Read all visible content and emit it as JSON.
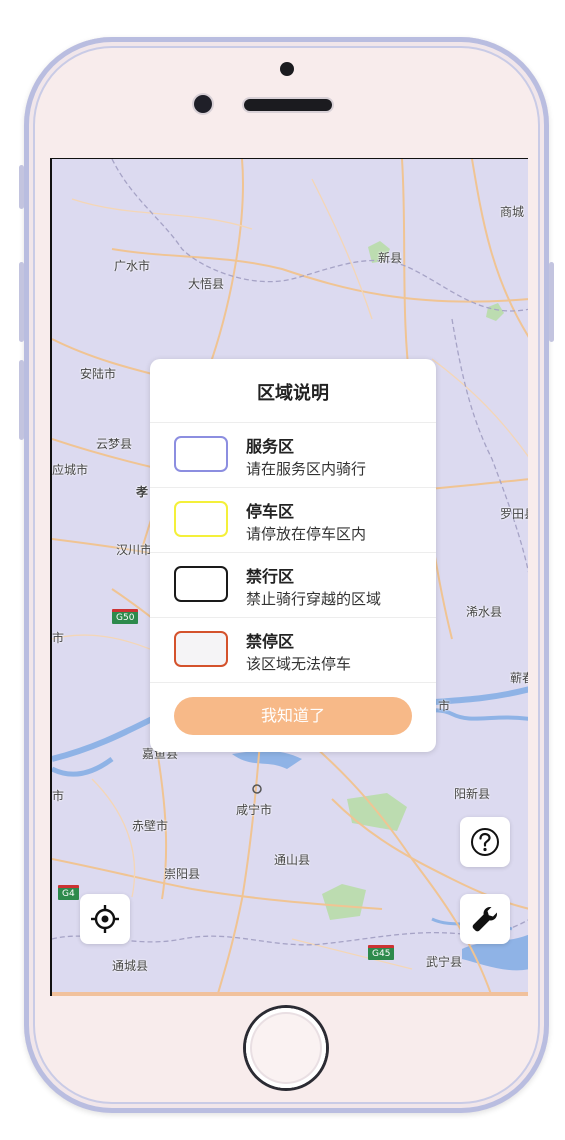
{
  "map": {
    "cities": [
      {
        "name": "商城",
        "id": "shangcheng"
      },
      {
        "name": "广水市",
        "id": "guangshui"
      },
      {
        "name": "大悟县",
        "id": "dawu"
      },
      {
        "name": "新县",
        "id": "xinxian"
      },
      {
        "name": "安陆市",
        "id": "anlu"
      },
      {
        "name": "云梦县",
        "id": "yunmeng"
      },
      {
        "name": "应城市",
        "id": "yingcheng"
      },
      {
        "name": "孝",
        "id": "xiao"
      },
      {
        "name": "汉川市",
        "id": "hanchuan"
      },
      {
        "name": "罗田县",
        "id": "luotian"
      },
      {
        "name": "浠水县",
        "id": "xishui"
      },
      {
        "name": "蕲春",
        "id": "qichun"
      },
      {
        "name": "市",
        "id": "city-edge"
      },
      {
        "name": "嘉鱼县",
        "id": "jiayu"
      },
      {
        "name": "阳新县",
        "id": "yangxin"
      },
      {
        "name": "咸宁市",
        "id": "xianning"
      },
      {
        "name": "赤壁市",
        "id": "chibi"
      },
      {
        "name": "崇阳县",
        "id": "chongyang"
      },
      {
        "name": "通山县",
        "id": "tongshan"
      },
      {
        "name": "通城县",
        "id": "tongcheng"
      },
      {
        "name": "武宁县",
        "id": "wuning"
      },
      {
        "name": "市",
        "id": "city-left"
      },
      {
        "name": "市",
        "id": "city-left2"
      }
    ],
    "highways": [
      "G50",
      "G4",
      "G45"
    ]
  },
  "dialog": {
    "title": "区域说明",
    "items": [
      {
        "name": "服务区",
        "desc": "请在服务区内骑行",
        "color": "#8c8ee0"
      },
      {
        "name": "停车区",
        "desc": "请停放在停车区内",
        "color": "#f4f03a"
      },
      {
        "name": "禁行区",
        "desc": "禁止骑行穿越的区域",
        "color": "#1a1a1a"
      },
      {
        "name": "禁停区",
        "desc": "该区域无法停车",
        "color": "#d4522c"
      }
    ],
    "ok_label": "我知道了"
  },
  "controls": {
    "help_icon": "question-circle-icon",
    "locate_icon": "crosshair-icon",
    "tools_icon": "wrench-icon"
  }
}
